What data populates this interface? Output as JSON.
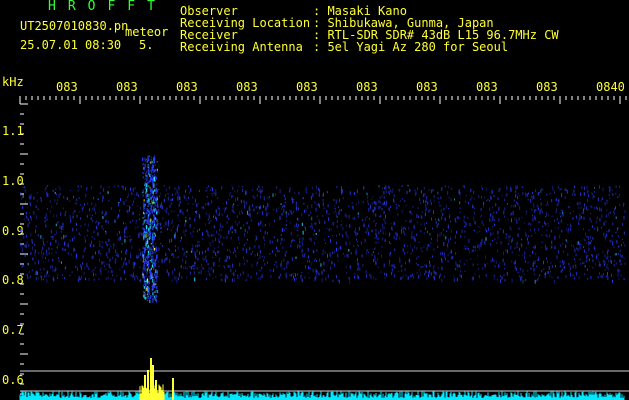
{
  "header": {
    "brand": "HROFFT",
    "filename": "UT2507010830.pn",
    "category": "meteor",
    "datetime": "25.07.01 08:30",
    "count": "5."
  },
  "info": {
    "labels": [
      "Observer",
      "Receiving Location",
      "Receiver",
      "Receiving Antenna"
    ],
    "values": [
      ": Masaki Kano",
      ": Shibukawa, Gunma, Japan",
      ": RTL-SDR SDR# 43dB L15 96.7MHz CW",
      ": 5el Yagi Az 280 for Seoul"
    ]
  },
  "axis": {
    "unit": "kHz",
    "time_labels": [
      "083",
      "083",
      "083",
      "083",
      "083",
      "083",
      "083",
      "083",
      "083",
      "0840"
    ],
    "freq_labels": [
      "1.1",
      "1.0",
      "0.9",
      "0.8",
      "0.7",
      "0.6"
    ]
  },
  "colors": {
    "background": "#000000",
    "text_green": "#33ff33",
    "text_yellow": "#ffff33",
    "tick": "#ffffff",
    "signal_blue": "#2a3cff",
    "signal_cyan": "#22e0ff",
    "signal_yellow": "#ffff33",
    "baseline_cyan": "#00e8ff"
  }
}
